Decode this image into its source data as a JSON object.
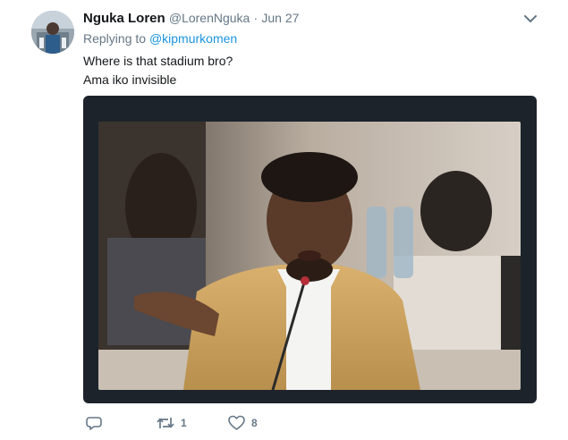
{
  "tweet": {
    "author_name": "Nguka Loren",
    "author_handle": "@LorenNguka",
    "separator": "·",
    "timestamp": "Jun 27",
    "replying_prefix": "Replying to",
    "replying_to": "@kipmurkomen",
    "text_lines": [
      "Where is that stadium bro?",
      "Ama iko invisible"
    ],
    "retweet_count": "1",
    "like_count": "8"
  },
  "icons": {
    "more": "chevron-down-icon",
    "reply": "reply-icon",
    "retweet": "retweet-icon",
    "like": "heart-icon"
  },
  "colors": {
    "link": "#1b95e0",
    "secondary_text": "#657786",
    "primary_text": "#14171a",
    "media_background": "#1c232b"
  }
}
